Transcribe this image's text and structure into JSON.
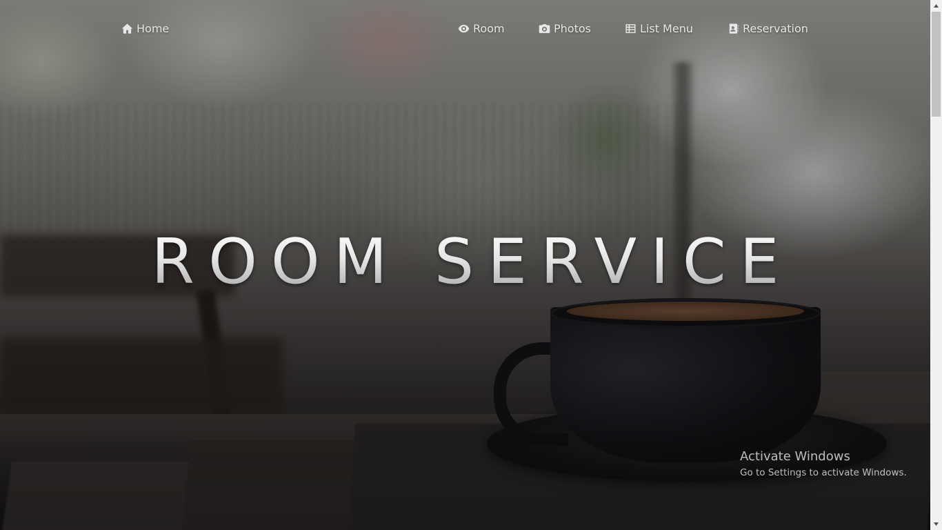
{
  "nav": {
    "items": [
      {
        "label": "Home",
        "icon": "home-icon"
      },
      {
        "label": "Room",
        "icon": "eye-icon"
      },
      {
        "label": "Photos",
        "icon": "camera-icon"
      },
      {
        "label": "List Menu",
        "icon": "list-icon"
      },
      {
        "label": "Reservation",
        "icon": "contact-book-icon"
      }
    ]
  },
  "hero": {
    "title": "ROOM SERVICE"
  },
  "watermark": {
    "title": "Activate Windows",
    "subtitle": "Go to Settings to activate Windows."
  },
  "colors": {
    "nav_text": "#e8e8e8",
    "title_top": "#ffffff",
    "title_bottom": "#9c9c9c",
    "scrollbar_track": "#f1f1f1",
    "scrollbar_thumb": "#c1c1c1"
  },
  "scrollbar": {
    "up_icon": "arrow-up-icon",
    "down_icon": "arrow-down-icon"
  }
}
